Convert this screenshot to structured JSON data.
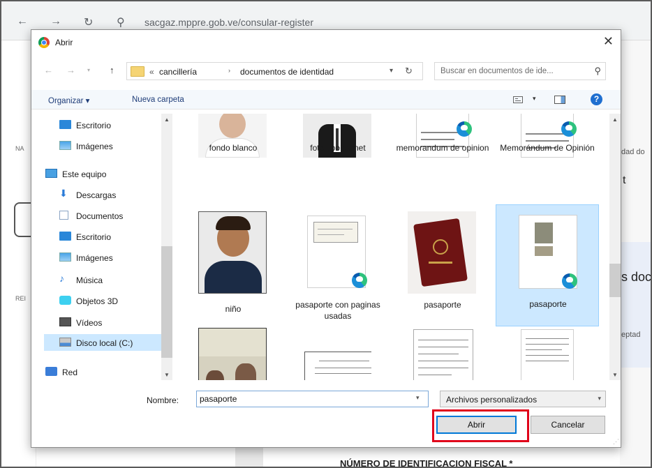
{
  "browser": {
    "url": "sacgaz.mppre.gob.ve/consular-register",
    "bg_labels": {
      "left_top": "NA",
      "left_mid": "REI",
      "right_1": "dad do",
      "right_2": "t",
      "right_3": "s doc",
      "right_4": "eptad",
      "bottom_heading": "NÚMERO DE IDENTIFICACION FISCAL *"
    }
  },
  "dialog": {
    "title": "Abrir",
    "close_glyph": "✕",
    "path": {
      "prefix": "«",
      "crumbs": [
        "cancillería",
        "documentos de identidad"
      ],
      "separator": "›"
    },
    "search_placeholder": "Buscar en documentos de ide...",
    "toolbar": {
      "organize": "Organizar ▾",
      "new_folder": "Nueva carpeta"
    },
    "nav_items": [
      {
        "label": "Escritorio",
        "icon": "desktop-icon",
        "level": "child"
      },
      {
        "label": "Imágenes",
        "icon": "pictures-icon",
        "level": "child"
      },
      {
        "label": "Este equipo",
        "icon": "this-pc-icon",
        "level": "top"
      },
      {
        "label": "Descargas",
        "icon": "downloads-icon",
        "level": "child"
      },
      {
        "label": "Documentos",
        "icon": "documents-icon",
        "level": "child"
      },
      {
        "label": "Escritorio",
        "icon": "desktop-icon",
        "level": "child"
      },
      {
        "label": "Imágenes",
        "icon": "pictures-icon",
        "level": "child"
      },
      {
        "label": "Música",
        "icon": "music-icon",
        "level": "child"
      },
      {
        "label": "Objetos 3D",
        "icon": "3d-objects-icon",
        "level": "child"
      },
      {
        "label": "Vídeos",
        "icon": "videos-icon",
        "level": "child"
      },
      {
        "label": "Disco local (C:)",
        "icon": "local-disk-icon",
        "level": "child",
        "selected": true
      },
      {
        "label": "Red",
        "icon": "network-icon",
        "level": "top"
      }
    ],
    "files": [
      {
        "name": "fondo blanco",
        "kind": "photo-woman"
      },
      {
        "name": "foto tipo carnet",
        "kind": "photo-suit"
      },
      {
        "name": "memorandum de opinion",
        "kind": "doc-edge"
      },
      {
        "name": "Memorándum de Opinión",
        "kind": "doc-edge"
      },
      {
        "name": "niño",
        "kind": "photo-child"
      },
      {
        "name": "pasaporte con paginas usadas",
        "kind": "doc-edge-passport"
      },
      {
        "name": "pasaporte",
        "kind": "photo-passport"
      },
      {
        "name": "pasaporte",
        "kind": "doc-edge-passport",
        "selected": true
      },
      {
        "name": "",
        "kind": "photo-passport-page"
      },
      {
        "name": "",
        "kind": "doc-certificate"
      },
      {
        "name": "",
        "kind": "doc-page"
      },
      {
        "name": "",
        "kind": "doc-edge"
      }
    ],
    "filename_label": "Nombre:",
    "filename_value": "pasaporte",
    "filetype_value": "Archivos personalizados",
    "open_label": "Abrir",
    "cancel_label": "Cancelar"
  },
  "colors": {
    "highlight": "#e0001a",
    "selection": "#cce8ff",
    "accent": "#0078d7"
  }
}
